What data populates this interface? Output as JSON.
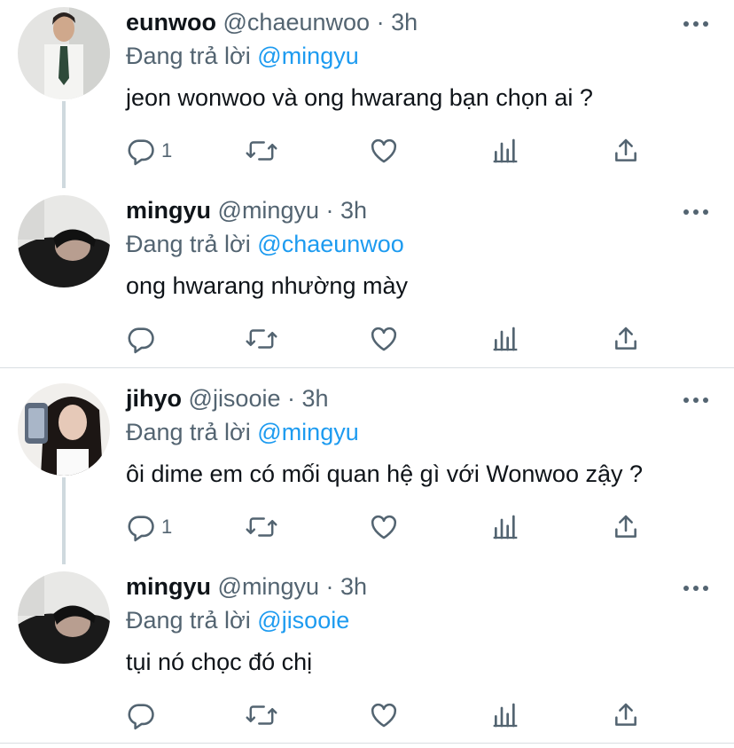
{
  "tweets": [
    {
      "name": "eunwoo",
      "handle": "@chaeunwoo",
      "dot": "·",
      "time": "3h",
      "reply_prefix": "Đang trả lời",
      "reply_mention": "@mingyu",
      "text": "jeon wonwoo và ong hwarang bạn chọn ai ?",
      "reply_count": "1"
    },
    {
      "name": "mingyu",
      "handle": "@mingyu",
      "dot": "·",
      "time": "3h",
      "reply_prefix": "Đang trả lời",
      "reply_mention": "@chaeunwoo",
      "text": "ong hwarang nhường mày",
      "reply_count": ""
    },
    {
      "name": "jihyo",
      "handle": "@jisooie",
      "dot": "·",
      "time": "3h",
      "reply_prefix": "Đang trả lời",
      "reply_mention": "@mingyu",
      "text": "ôi dime em có mối quan hệ gì với Wonwoo zậy ?",
      "reply_count": "1"
    },
    {
      "name": "mingyu",
      "handle": "@mingyu",
      "dot": "·",
      "time": "3h",
      "reply_prefix": "Đang trả lời",
      "reply_mention": "@jisooie",
      "text": "tụi nó chọc đó chị",
      "reply_count": ""
    }
  ],
  "colors": {
    "mention": "#1d9bf0",
    "secondary": "#536471",
    "thread_line": "#cfd9de"
  },
  "icons": [
    "reply-icon",
    "retweet-icon",
    "like-icon",
    "analytics-icon",
    "share-icon",
    "more-icon"
  ]
}
